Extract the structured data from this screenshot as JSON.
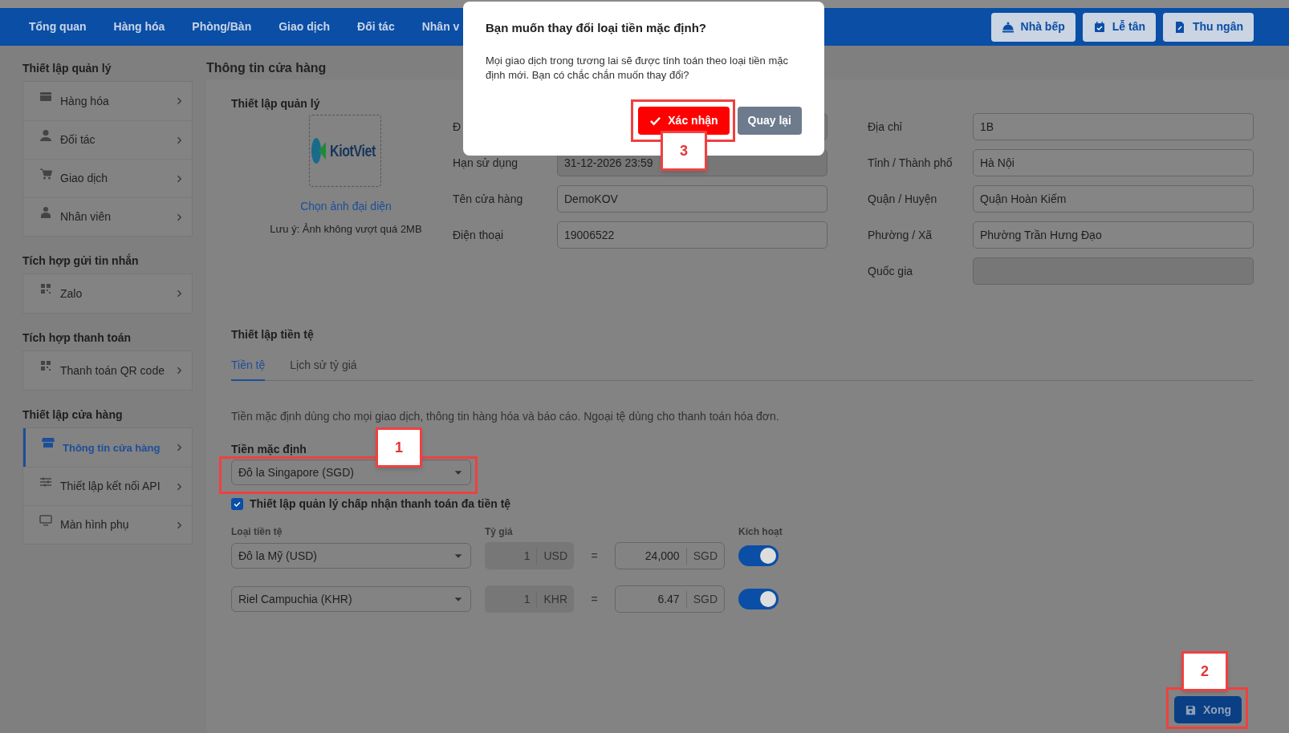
{
  "top_nav": {
    "items": [
      "Tổng quan",
      "Hàng hóa",
      "Phòng/Bàn",
      "Giao dịch",
      "Đối tác",
      "Nhân v"
    ],
    "buttons": [
      {
        "label": "Nhà bếp"
      },
      {
        "label": "Lễ tân"
      },
      {
        "label": "Thu ngân"
      }
    ]
  },
  "sidebar": {
    "sections": [
      {
        "title": "Thiết lập quản lý",
        "items": [
          {
            "label": "Hàng hóa",
            "selected": false
          },
          {
            "label": "Đối tác",
            "selected": false
          },
          {
            "label": "Giao dịch",
            "selected": false
          },
          {
            "label": "Nhân viên",
            "selected": false
          }
        ]
      },
      {
        "title": "Tích hợp gửi tin nhắn",
        "items": [
          {
            "label": "Zalo",
            "selected": false
          }
        ]
      },
      {
        "title": "Tích hợp thanh toán",
        "items": [
          {
            "label": "Thanh toán QR code",
            "selected": false
          }
        ]
      },
      {
        "title": "Thiết lập cửa hàng",
        "items": [
          {
            "label": "Thông tin cửa hàng",
            "selected": true
          },
          {
            "label": "Thiết lập kết nối API",
            "selected": false
          },
          {
            "label": "Màn hình phụ",
            "selected": false
          }
        ]
      }
    ]
  },
  "page_title": "Thông tin cửa hàng",
  "store_info": {
    "title": "Thiết lập quản lý",
    "logo_text": "KiotViet",
    "choose_photo": "Chọn ảnh đại diện",
    "note": "Lưu ý: Ảnh không vượt quá 2MB",
    "fields_left": [
      {
        "label": "Đ",
        "disabled": true
      },
      {
        "label": "Hạn sử dụng",
        "value": "31-12-2026 23:59",
        "disabled": true
      },
      {
        "label": "Tên cửa hàng",
        "value": "DemoKOV",
        "disabled": false
      },
      {
        "label": "Điện thoại",
        "value": "19006522",
        "disabled": false
      }
    ],
    "fields_right": [
      {
        "label": "Địa chỉ",
        "value": "1B",
        "disabled": false
      },
      {
        "label": "Tỉnh / Thành phố",
        "value": "Hà Nội",
        "disabled": false
      },
      {
        "label": "Quận / Huyện",
        "value": "Quận Hoàn Kiếm",
        "disabled": false
      },
      {
        "label": "Phường / Xã",
        "value": "Phường Trần Hưng Đạo",
        "disabled": false
      },
      {
        "label": "Quốc gia",
        "disabled": true
      }
    ]
  },
  "currency": {
    "title": "Thiết lập tiền tệ",
    "tabs": [
      {
        "label": "Tiền tệ",
        "selected": true
      },
      {
        "label": "Lịch sử tỷ giá",
        "selected": false
      }
    ],
    "description": "Tiền mặc định dùng cho mọi giao dịch, thông tin hàng hóa và báo cáo. Ngoại tệ dùng cho thanh toán hóa đơn.",
    "default_label": "Tiền mặc định",
    "default_value": "Đô la Singapore (SGD)",
    "multi_currency": {
      "label": "Thiết lập quản lý chấp nhận thanh toán đa tiền tệ",
      "checked": true
    },
    "columns": [
      "Loại tiền tệ",
      "Tỷ giá",
      "Kích hoạt"
    ],
    "rows": [
      {
        "currency": "Đô la Mỹ (USD)",
        "amount": "1",
        "unit": "USD",
        "equals": "=",
        "rate": "24,000",
        "base": "SGD",
        "on": true
      },
      {
        "currency": "Riel Campuchia (KHR)",
        "amount": "1",
        "unit": "KHR",
        "equals": "=",
        "rate": "6.47",
        "base": "SGD",
        "on": true
      }
    ]
  },
  "save_button": "Xong",
  "dialog": {
    "title": "Bạn muốn thay đổi loại tiền mặc định?",
    "message": "Mọi giao dịch trong tương lai sẽ được tính toán theo loại tiền mặc định mới. Bạn có chắc chắn muốn thay đổi?",
    "confirm": "Xác nhận",
    "back": "Quay lại"
  },
  "annotations": [
    {
      "number": "1"
    },
    {
      "number": "2"
    },
    {
      "number": "3"
    }
  ]
}
